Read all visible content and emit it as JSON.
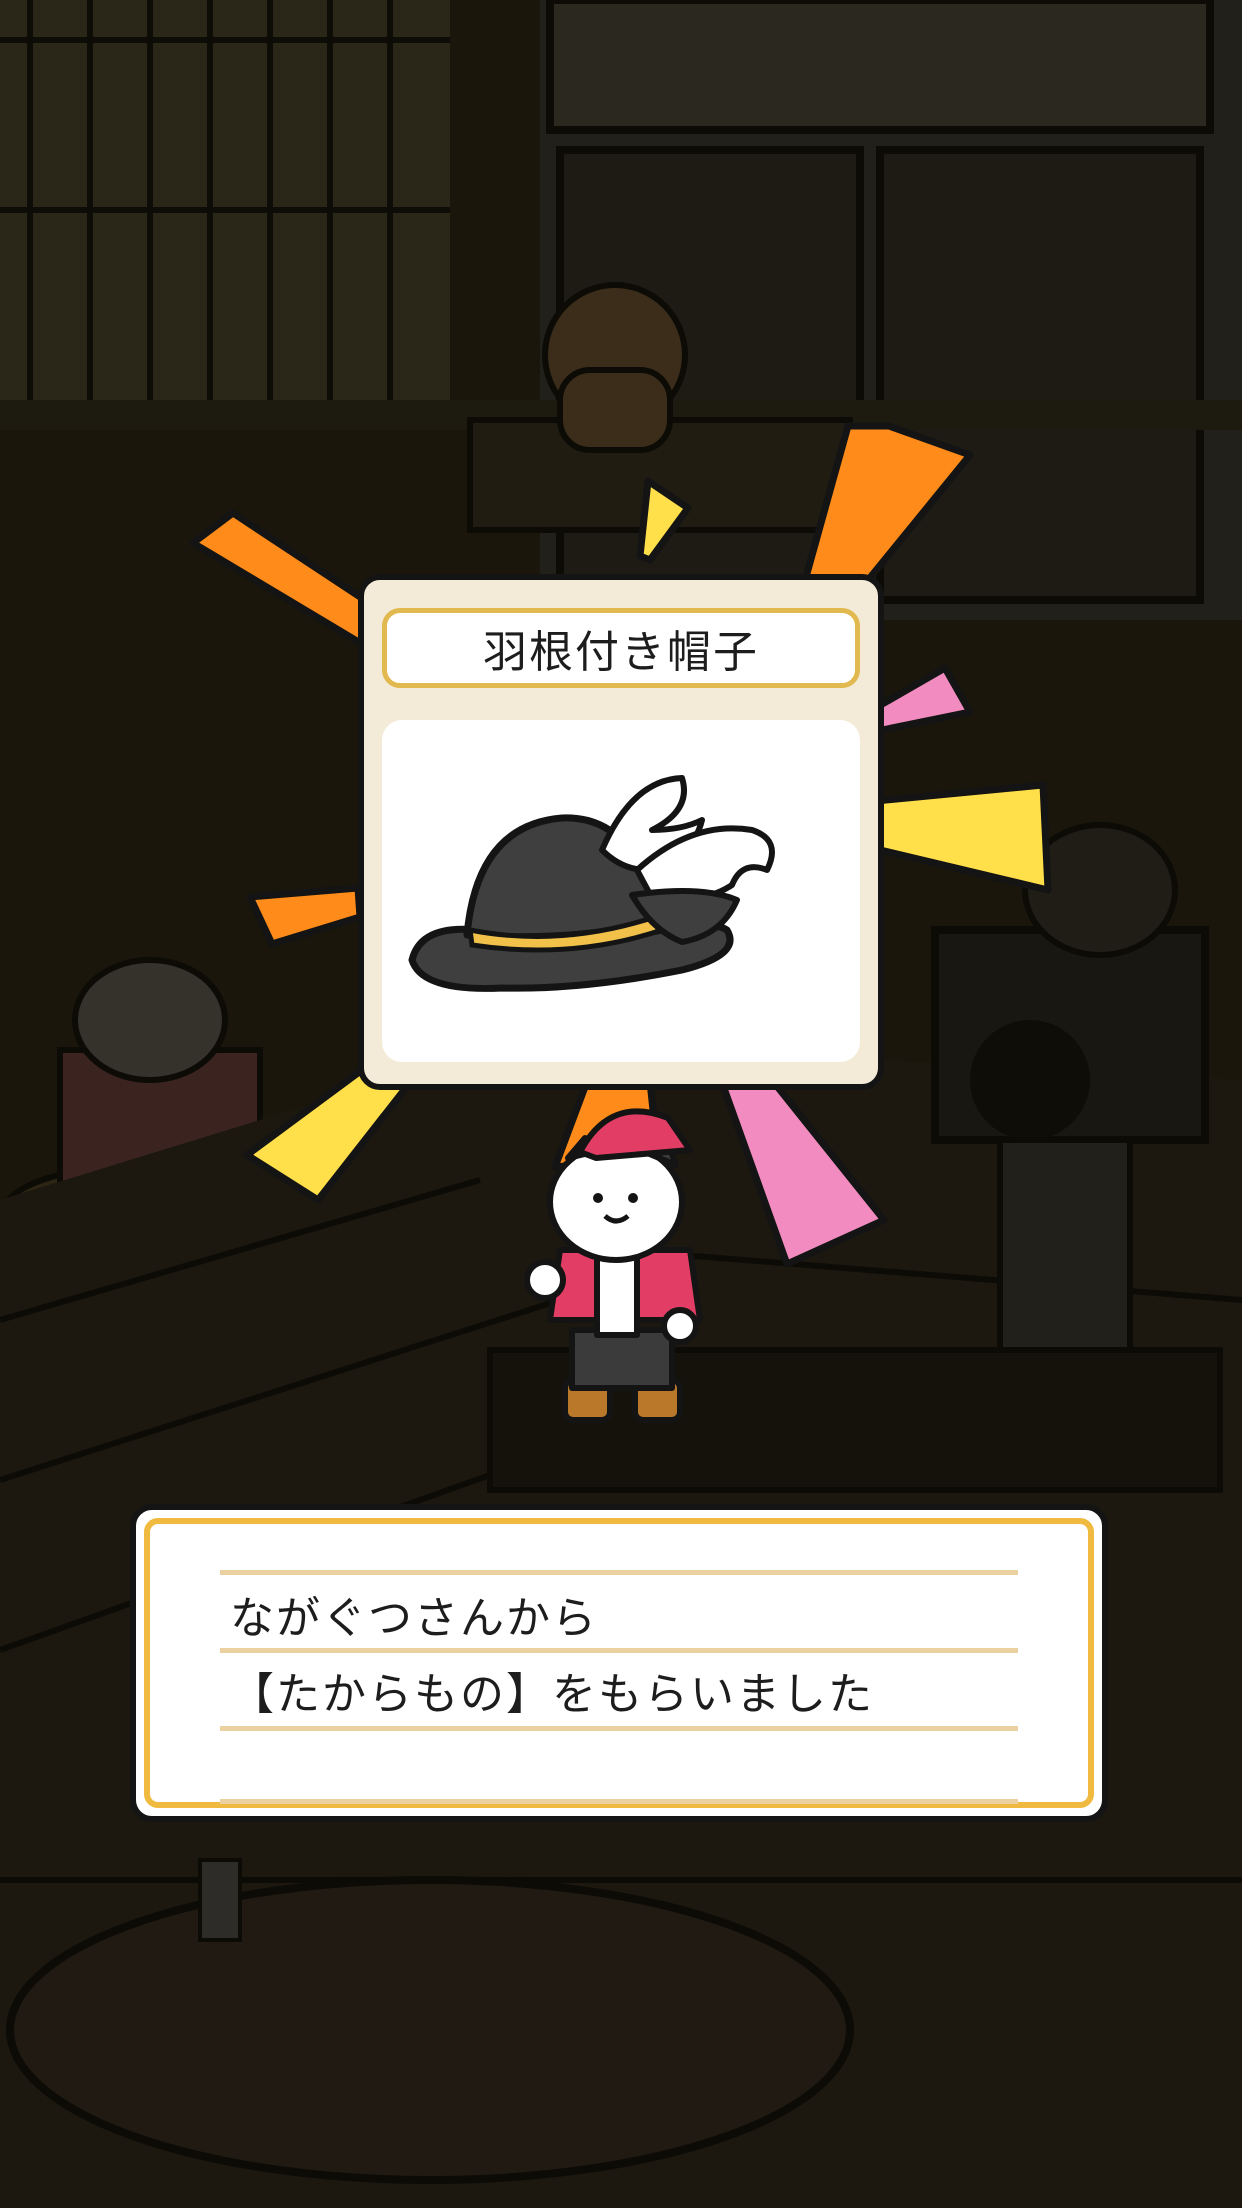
{
  "scene": {
    "name": "cat yard backyard room (dimmed)"
  },
  "reward": {
    "item_name": "羽根付き帽子",
    "item_icon": "feathered-hat-icon",
    "cat_name": "ながぐつさん"
  },
  "message": {
    "line1": "ながぐつさんから",
    "line2": "【たからもの】をもらいました",
    "line3": ""
  },
  "colors": {
    "ray_orange": "#ff8c1a",
    "ray_yellow": "#ffe04a",
    "ray_pink": "#f28cc0",
    "card_border": "#e2b94e",
    "message_border": "#f0b93f"
  }
}
